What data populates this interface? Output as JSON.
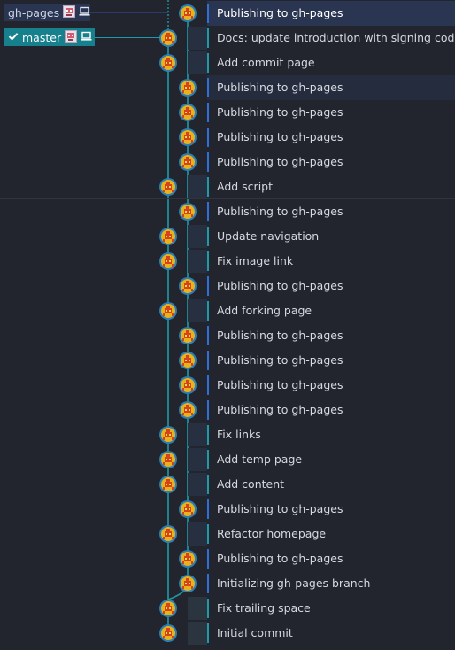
{
  "colors": {
    "background": "#22252d",
    "master_lane": "#1f9aa6",
    "ghpages_lane": "#2f6fd8",
    "selected_row": "#2a3552",
    "master_tag_bg": "#16818c",
    "ghpages_tag_bg": "#2a3552",
    "avatar_ring": "#e8b21a",
    "avatar_face": "#d4421e"
  },
  "branches": {
    "ghpages": {
      "label": "gh-pages",
      "icons": [
        "avatar-icon",
        "laptop-icon"
      ]
    },
    "master": {
      "label": "master",
      "checked": true,
      "icons": [
        "check-icon",
        "avatar-icon",
        "laptop-icon"
      ]
    }
  },
  "commits": [
    {
      "message": "Publishing to gh-pages",
      "lane": "gh-pages",
      "selected": true
    },
    {
      "message": "Docs: update introduction with signing code",
      "lane": "master"
    },
    {
      "message": "Add commit page",
      "lane": "master"
    },
    {
      "message": "Publishing to gh-pages",
      "lane": "gh-pages",
      "highlight": true
    },
    {
      "message": "Publishing to gh-pages",
      "lane": "gh-pages"
    },
    {
      "message": "Publishing to gh-pages",
      "lane": "gh-pages"
    },
    {
      "message": "Publishing to gh-pages",
      "lane": "gh-pages"
    },
    {
      "message": "Add script",
      "lane": "master"
    },
    {
      "message": "Publishing to gh-pages",
      "lane": "gh-pages"
    },
    {
      "message": "Update navigation",
      "lane": "master"
    },
    {
      "message": "Fix image link",
      "lane": "master"
    },
    {
      "message": "Publishing to gh-pages",
      "lane": "gh-pages"
    },
    {
      "message": "Add forking page",
      "lane": "master"
    },
    {
      "message": "Publishing to gh-pages",
      "lane": "gh-pages"
    },
    {
      "message": "Publishing to gh-pages",
      "lane": "gh-pages"
    },
    {
      "message": "Publishing to gh-pages",
      "lane": "gh-pages"
    },
    {
      "message": "Publishing to gh-pages",
      "lane": "gh-pages"
    },
    {
      "message": "Fix links",
      "lane": "master"
    },
    {
      "message": "Add temp page",
      "lane": "master"
    },
    {
      "message": "Add content",
      "lane": "master"
    },
    {
      "message": "Publishing to gh-pages",
      "lane": "gh-pages"
    },
    {
      "message": "Refactor homepage",
      "lane": "master"
    },
    {
      "message": "Publishing to gh-pages",
      "lane": "gh-pages"
    },
    {
      "message": "Initializing gh-pages branch",
      "lane": "gh-pages"
    },
    {
      "message": "Fix trailing space",
      "lane": "master"
    },
    {
      "message": "Initial commit",
      "lane": "master"
    }
  ]
}
